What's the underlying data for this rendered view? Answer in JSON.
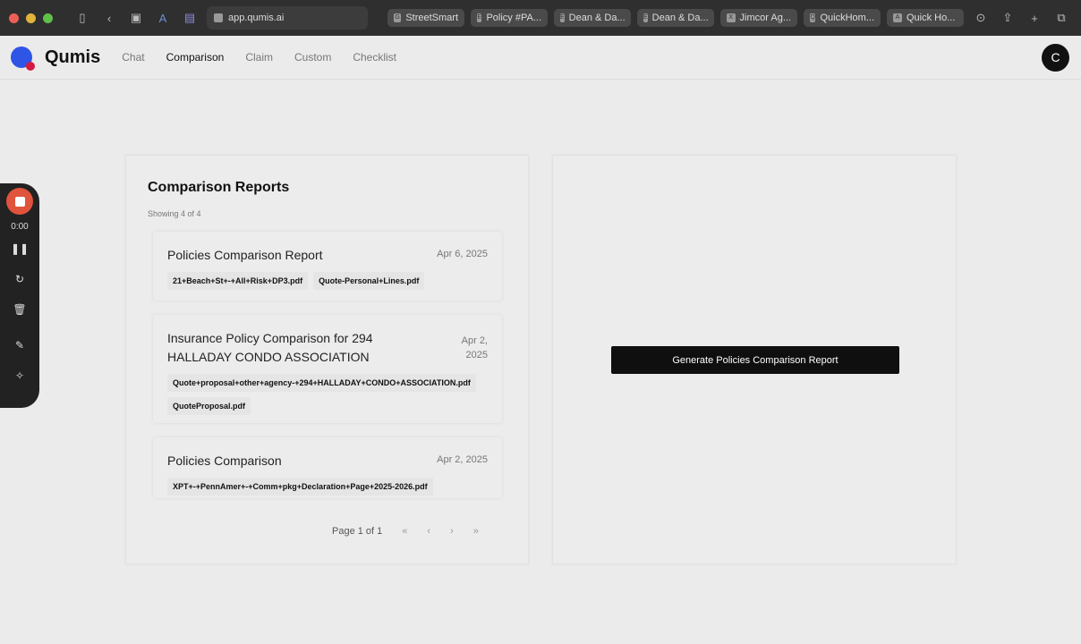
{
  "browser": {
    "url": "app.qumis.ai",
    "tabs": [
      {
        "label": "StreetSmart",
        "icon": "G"
      },
      {
        "label": "Policy #PA...",
        "icon": "E"
      },
      {
        "label": "Dean & Da...",
        "icon": "E"
      },
      {
        "label": "Dean & Da...",
        "icon": "E"
      },
      {
        "label": "Jimcor Ag...",
        "icon": "X"
      },
      {
        "label": "QuickHom...",
        "icon": "Q"
      },
      {
        "label": "Quick Ho...",
        "icon": "A"
      }
    ]
  },
  "nav": {
    "brand": "Qumis",
    "items": [
      "Chat",
      "Comparison",
      "Claim",
      "Custom",
      "Checklist"
    ],
    "active": "Comparison",
    "avatar": "C"
  },
  "recorder": {
    "time": "0:00"
  },
  "reports": {
    "title": "Comparison Reports",
    "count": "Showing 4 of 4",
    "items": [
      {
        "title": "Policies Comparison Report",
        "date": "Apr 6, 2025",
        "files": [
          "21+Beach+St+-+All+Risk+DP3.pdf",
          "Quote-Personal+Lines.pdf"
        ]
      },
      {
        "title": "Insurance Policy Comparison for 294 HALLADAY CONDO ASSOCIATION",
        "date": "Apr 2, 2025",
        "files": [
          "Quote+proposal+other+agency-+294+HALLADAY+CONDO+ASSOCIATION.pdf",
          "QuoteProposal.pdf"
        ]
      },
      {
        "title": "Policies Comparison",
        "date": "Apr 2, 2025",
        "files": [
          "XPT+-+PennAmer+-+Comm+pkg+Declaration+Page+2025-2026.pdf"
        ]
      }
    ],
    "page": "Page 1 of 1",
    "pager": {
      "first": "«",
      "prev": "‹",
      "next": "›",
      "last": "»"
    }
  },
  "generate_label": "Generate Policies Comparison Report"
}
